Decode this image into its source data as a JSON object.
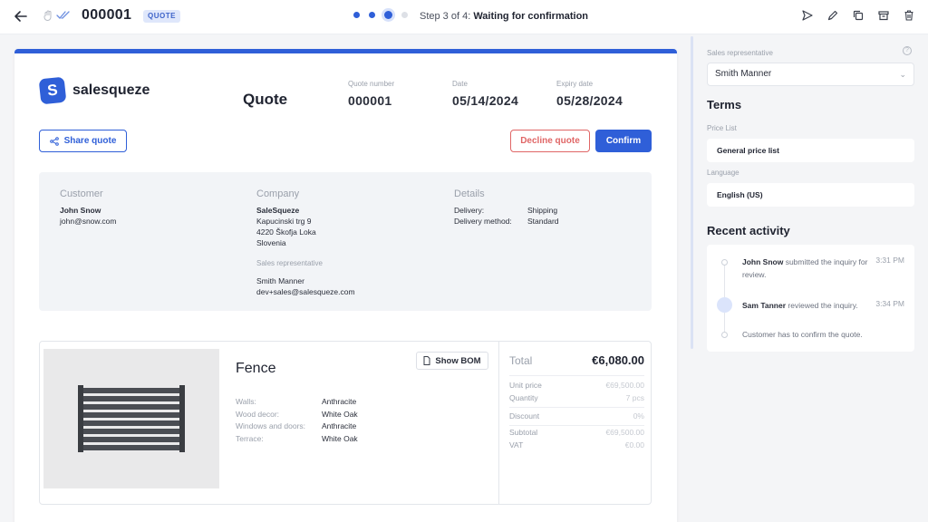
{
  "topbar": {
    "quote_number": "000001",
    "badge": "QUOTE",
    "step_prefix": "Step 3 of 4:",
    "step_status": "Waiting for confirmation"
  },
  "document": {
    "brand": "salesqueze",
    "logo_letter": "S",
    "title": "Quote",
    "quote_number_label": "Quote number",
    "quote_number": "000001",
    "date_label": "Date",
    "date": "05/14/2024",
    "expiry_label": "Expiry date",
    "expiry": "05/28/2024",
    "share_label": "Share quote",
    "decline_label": "Decline quote",
    "confirm_label": "Confirm"
  },
  "customer": {
    "heading": "Customer",
    "name": "John Snow",
    "email": "john@snow.com"
  },
  "company": {
    "heading": "Company",
    "name": "SaleSqueze",
    "address1": "Kapucinski trg 9",
    "address2": "4220 Škofja Loka",
    "country": "Slovenia",
    "rep_label": "Sales representative",
    "rep_name": "Smith Manner",
    "rep_email": "dev+sales@salesqueze.com"
  },
  "details": {
    "heading": "Details",
    "delivery_label": "Delivery:",
    "delivery_value": "Shipping",
    "method_label": "Delivery method:",
    "method_value": "Standard"
  },
  "product": {
    "name": "Fence",
    "bom_label": "Show BOM",
    "attributes": [
      {
        "key": "Walls:",
        "value": "Anthracite"
      },
      {
        "key": "Wood decor:",
        "value": "White Oak"
      },
      {
        "key": "Windows and doors:",
        "value": "Anthracite"
      },
      {
        "key": "Terrace:",
        "value": "White Oak"
      }
    ],
    "total_label": "Total",
    "total": "€6,080.00",
    "unit_price_label": "Unit price",
    "unit_price": "€69,500.00",
    "quantity_label": "Quantity",
    "quantity": "7 pcs",
    "discount_label": "Discount",
    "discount": "0%",
    "subtotal_label": "Subtotal",
    "subtotal": "€69,500.00",
    "vat_label": "VAT",
    "vat": "€0.00"
  },
  "sidebar": {
    "rep_label": "Sales representative",
    "rep_value": "Smith Manner",
    "terms_heading": "Terms",
    "price_list_label": "Price List",
    "price_list_value": "General price list",
    "language_label": "Language",
    "language_value": "English (US)",
    "activity_heading": "Recent activity",
    "activity": [
      {
        "actor": "John Snow",
        "text": " submitted the inquiry for review.",
        "time": "3:31 PM"
      },
      {
        "actor": "Sam Tanner",
        "text": " reviewed the inquiry.",
        "time": "3:34 PM"
      },
      {
        "actor": "",
        "text": "Customer has to confirm the quote.",
        "time": ""
      }
    ]
  },
  "colors": {
    "accent": "#2f5fd8",
    "danger": "#e06666"
  }
}
